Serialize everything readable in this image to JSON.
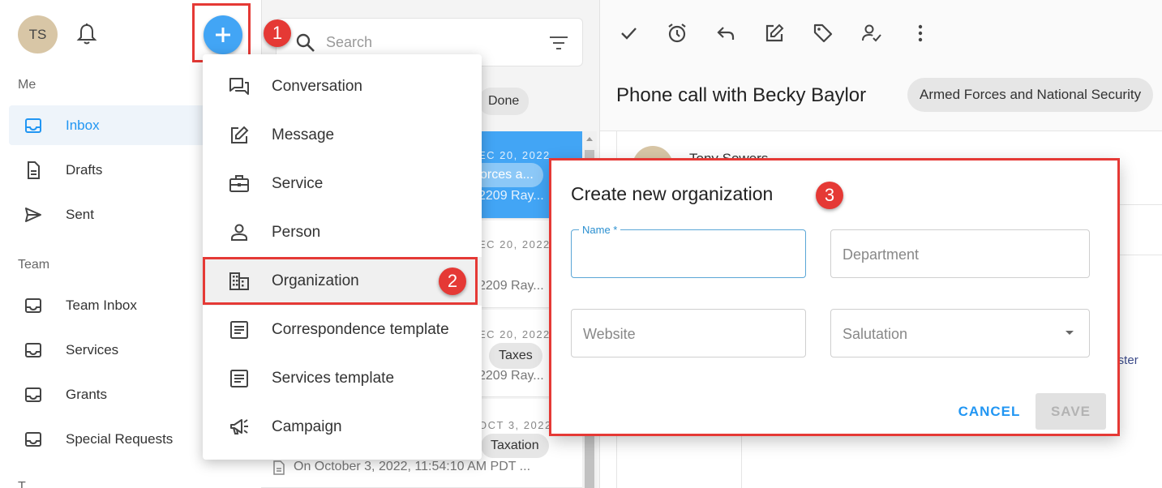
{
  "sidebar": {
    "avatar_initials": "TS",
    "section_me": "Me",
    "section_team": "Team",
    "section_more": "T",
    "me_items": [
      {
        "label": "Inbox",
        "icon": "inbox-icon",
        "active": true
      },
      {
        "label": "Drafts",
        "icon": "document-icon",
        "active": false
      },
      {
        "label": "Sent",
        "icon": "send-icon",
        "active": false
      }
    ],
    "team_items": [
      {
        "label": "Team Inbox",
        "icon": "inbox-icon"
      },
      {
        "label": "Services",
        "icon": "inbox-icon"
      },
      {
        "label": "Grants",
        "icon": "inbox-icon"
      },
      {
        "label": "Special Requests",
        "icon": "inbox-icon"
      }
    ]
  },
  "list": {
    "search_placeholder": "Search",
    "filter_chip": "Done",
    "cards": [
      {
        "date": "EC 20, 2022",
        "chip": "orces a...",
        "text": "2209 Ray..."
      },
      {
        "date": "EC 20, 2022",
        "chip": "",
        "text": "2209 Ray..."
      },
      {
        "date": "EC 20, 2022",
        "chip": "Taxes",
        "text": "2209 Ray..."
      },
      {
        "date": "OCT 3, 2022",
        "chip": "Taxation",
        "text": "On October 3, 2022, 11:54:10 AM PDT ..."
      }
    ]
  },
  "detail": {
    "title": "Phone call with Becky Baylor",
    "topic_chip": "Armed Forces and National Security",
    "author_partial": "Tony Sowers",
    "side_text": "buster",
    "toolbar_icons": [
      "check-icon",
      "alarm-icon",
      "reply-icon",
      "edit-icon",
      "tag-icon",
      "assign-icon",
      "more-vert-icon"
    ]
  },
  "menu": {
    "items": [
      {
        "label": "Conversation",
        "icon": "conversation-icon"
      },
      {
        "label": "Message",
        "icon": "edit-icon"
      },
      {
        "label": "Service",
        "icon": "briefcase-icon"
      },
      {
        "label": "Person",
        "icon": "person-icon"
      },
      {
        "label": "Organization",
        "icon": "building-icon"
      },
      {
        "label": "Correspondence template",
        "icon": "template-icon"
      },
      {
        "label": "Services template",
        "icon": "template-icon"
      },
      {
        "label": "Campaign",
        "icon": "megaphone-icon"
      }
    ]
  },
  "dialog": {
    "title": "Create new organization",
    "name_label": "Name *",
    "department_placeholder": "Department",
    "website_placeholder": "Website",
    "salutation_placeholder": "Salutation",
    "cancel_label": "CANCEL",
    "save_label": "SAVE"
  },
  "annotations": {
    "step1": "1",
    "step2": "2",
    "step3": "3",
    "color": "#e53935"
  },
  "colors": {
    "accent": "#2196f3",
    "selected_card": "#42a5f5",
    "add_button": "#42a5f5"
  }
}
